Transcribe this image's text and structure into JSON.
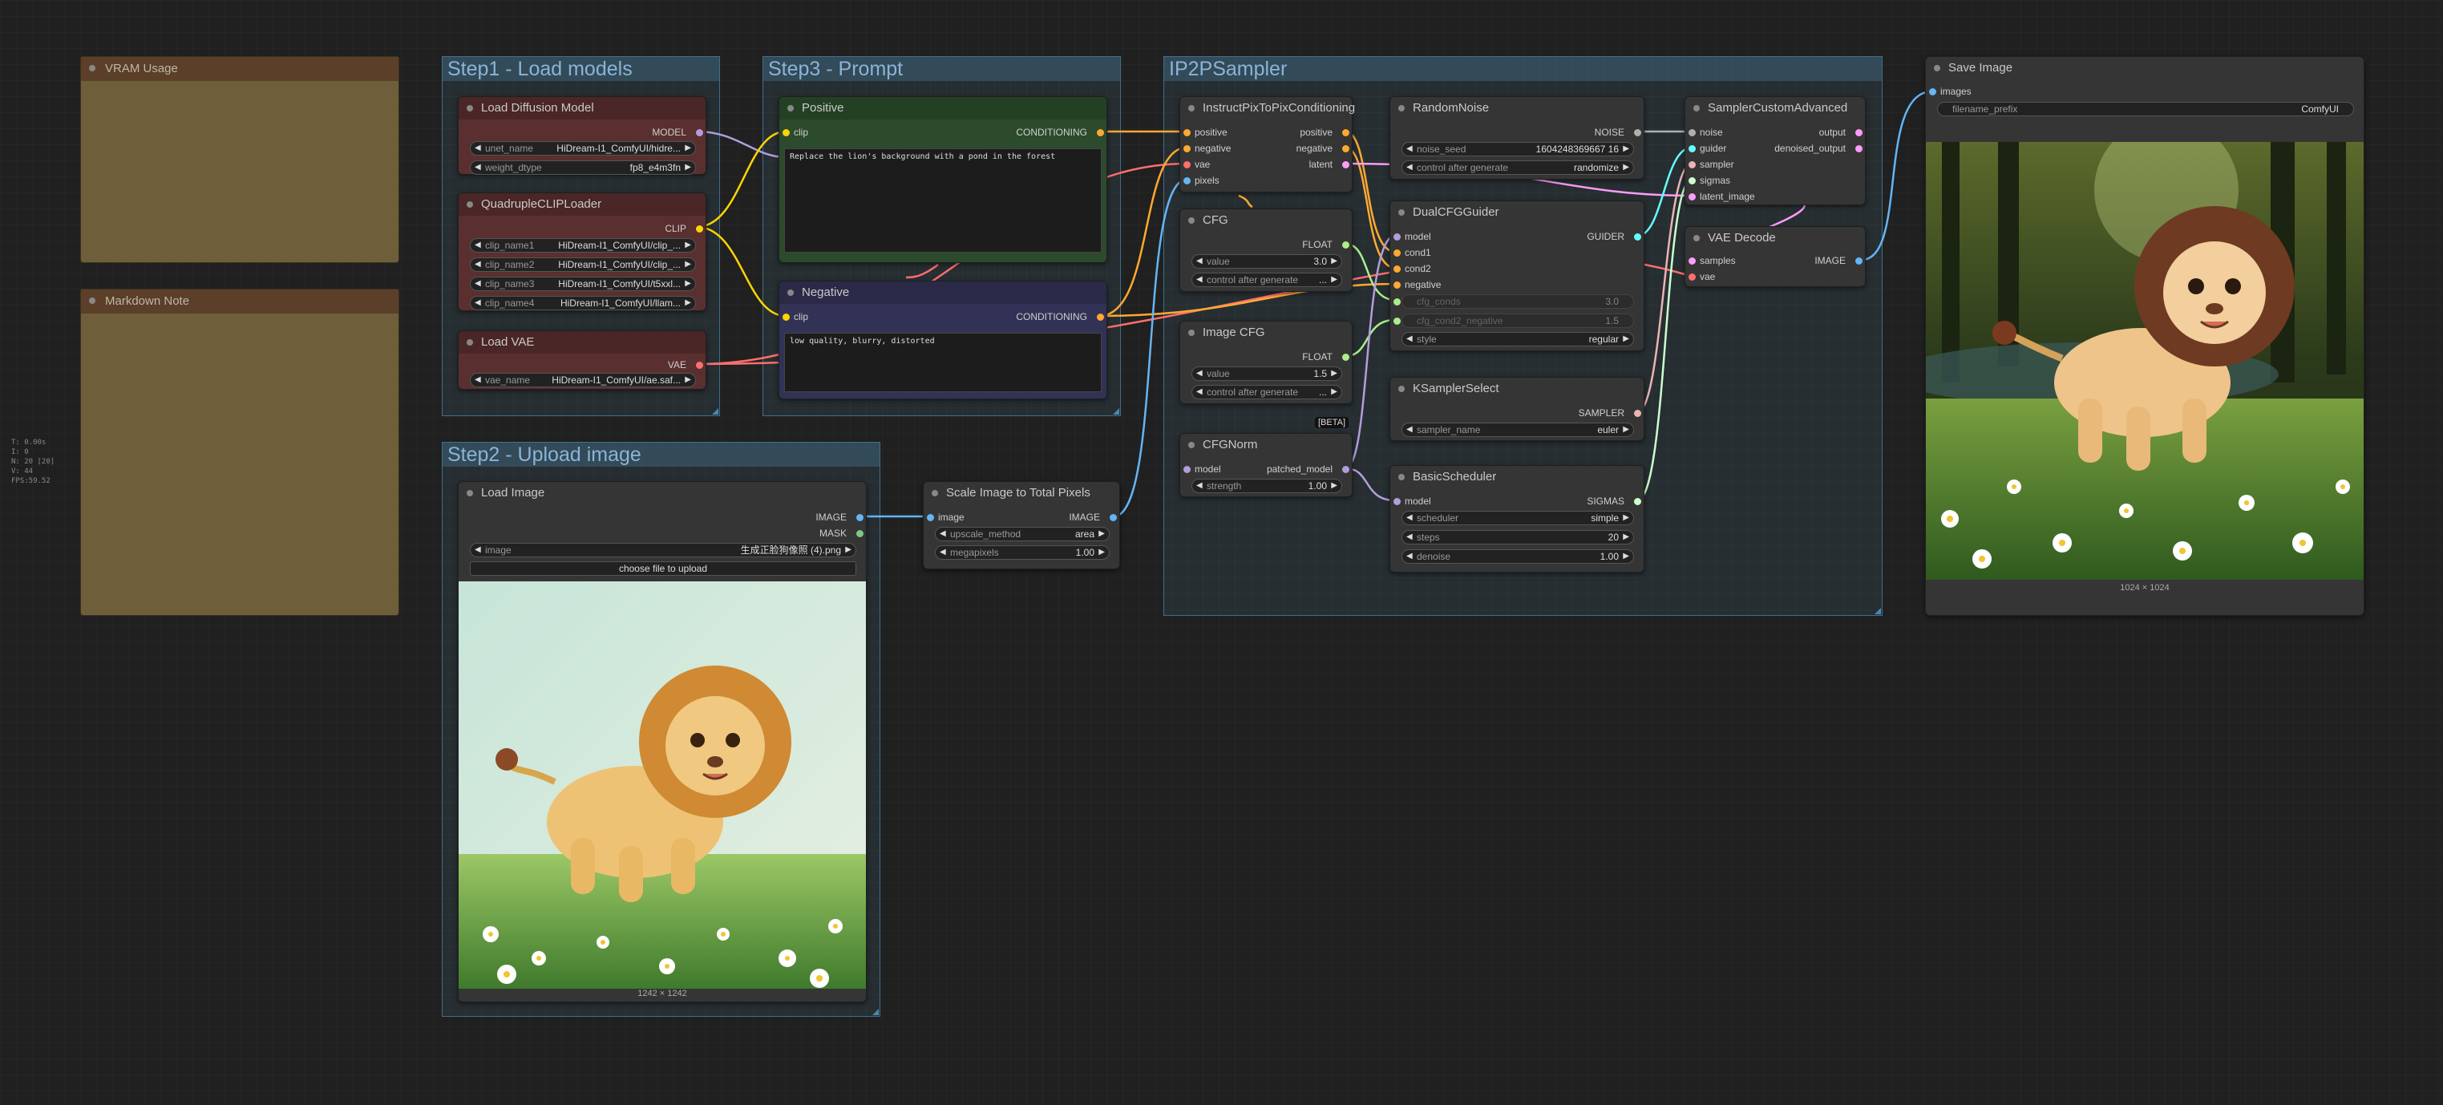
{
  "stats": [
    "T: 0.00s",
    "I: 0",
    "N: 20 [20]",
    "V: 44",
    "FPS:59.52"
  ],
  "notes": {
    "vram": "VRAM Usage",
    "markdown": "Markdown Note"
  },
  "groups": {
    "step1": "Step1 - Load models",
    "step2": "Step2 - Upload image",
    "step3": "Step3 - Prompt",
    "ip2p": "IP2PSampler"
  },
  "nodes": {
    "load_diffusion": {
      "title": "Load Diffusion Model",
      "out": "MODEL",
      "w1_label": "unet_name",
      "w1_value": "HiDream-I1_ComfyUI/hidre...",
      "w2_label": "weight_dtype",
      "w2_value": "fp8_e4m3fn"
    },
    "quad_clip": {
      "title": "QuadrupleCLIPLoader",
      "out": "CLIP",
      "w1_label": "clip_name1",
      "w1_value": "HiDream-I1_ComfyUI/clip_...",
      "w2_label": "clip_name2",
      "w2_value": "HiDream-I1_ComfyUI/clip_...",
      "w3_label": "clip_name3",
      "w3_value": "HiDream-I1_ComfyUI/t5xxl...",
      "w4_label": "clip_name4",
      "w4_value": "HiDream-I1_ComfyUI/llam..."
    },
    "load_vae": {
      "title": "Load VAE",
      "out": "VAE",
      "w1_label": "vae_name",
      "w1_value": "HiDream-I1_ComfyUI/ae.saf..."
    },
    "positive": {
      "title": "Positive",
      "in": "clip",
      "out": "CONDITIONING",
      "text": "Replace the lion's background with a pond in the forest"
    },
    "negative": {
      "title": "Negative",
      "in": "clip",
      "out": "CONDITIONING",
      "text": "low quality, blurry, distorted"
    },
    "load_image": {
      "title": "Load Image",
      "out1": "IMAGE",
      "out2": "MASK",
      "w1_label": "image",
      "w1_value": "生成正脸狗像照 (4).png",
      "button": "choose file to upload",
      "caption": "1242 × 1242"
    },
    "scale_image": {
      "title": "Scale Image to Total Pixels",
      "in": "image",
      "out": "IMAGE",
      "w1_label": "upscale_method",
      "w1_value": "area",
      "w2_label": "megapixels",
      "w2_value": "1.00"
    },
    "ip2p_cond": {
      "title": "InstructPixToPixConditioning",
      "in1": "positive",
      "in2": "negative",
      "in3": "vae",
      "in4": "pixels",
      "out1": "positive",
      "out2": "negative",
      "out3": "latent"
    },
    "cfg": {
      "title": "CFG",
      "out": "FLOAT",
      "w1_label": "value",
      "w1_value": "3.0",
      "w2_label": "control after generate",
      "w2_value": "..."
    },
    "image_cfg": {
      "title": "Image CFG",
      "out": "FLOAT",
      "w1_label": "value",
      "w1_value": "1.5",
      "w2_label": "control after generate",
      "w2_value": "...",
      "badge": "[BETA]"
    },
    "cfgnorm": {
      "title": "CFGNorm",
      "in": "model",
      "out": "patched_model",
      "w1_label": "strength",
      "w1_value": "1.00"
    },
    "random_noise": {
      "title": "RandomNoise",
      "out": "NOISE",
      "w1_label": "noise_seed",
      "w1_value": "1604248369667 16",
      "w2_label": "control after generate",
      "w2_value": "randomize"
    },
    "dual_cfg": {
      "title": "DualCFGGuider",
      "in1": "model",
      "in2": "cond1",
      "in3": "cond2",
      "in4": "negative",
      "in5": "cfg_conds",
      "in6": "cfg_cond2_negative",
      "out": "GUIDER",
      "w1_label": "cfg_conds",
      "w1_value": "3.0",
      "w2_label": "cfg_cond2_negative",
      "w2_value": "1.5",
      "w3_label": "style",
      "w3_value": "regular"
    },
    "ksampler_select": {
      "title": "KSamplerSelect",
      "out": "SAMPLER",
      "w1_label": "sampler_name",
      "w1_value": "euler"
    },
    "basic_scheduler": {
      "title": "BasicScheduler",
      "in": "model",
      "out": "SIGMAS",
      "w1_label": "scheduler",
      "w1_value": "simple",
      "w2_label": "steps",
      "w2_value": "20",
      "w3_label": "denoise",
      "w3_value": "1.00"
    },
    "sampler_custom": {
      "title": "SamplerCustomAdvanced",
      "in1": "noise",
      "in2": "guider",
      "in3": "sampler",
      "in4": "sigmas",
      "in5": "latent_image",
      "out1": "output",
      "out2": "denoised_output"
    },
    "vae_decode": {
      "title": "VAE Decode",
      "in1": "samples",
      "in2": "vae",
      "out": "IMAGE"
    },
    "save_image": {
      "title": "Save Image",
      "in": "images",
      "w1_label": "filename_prefix",
      "w1_value": "ComfyUI",
      "caption": "1024 × 1024"
    }
  },
  "colors": {
    "model": "#b39ddb",
    "clip": "#ffd500",
    "vae": "#ff6e6e",
    "conditioning": "#ffa931",
    "image": "#64b5f6",
    "latent": "#ff9cf9",
    "float": "#aaee88",
    "noise": "#b0b0b0",
    "guider": "#66ffff",
    "sampler": "#ecb4b4",
    "sigmas": "#cdffcd",
    "mask": "#81c784"
  }
}
